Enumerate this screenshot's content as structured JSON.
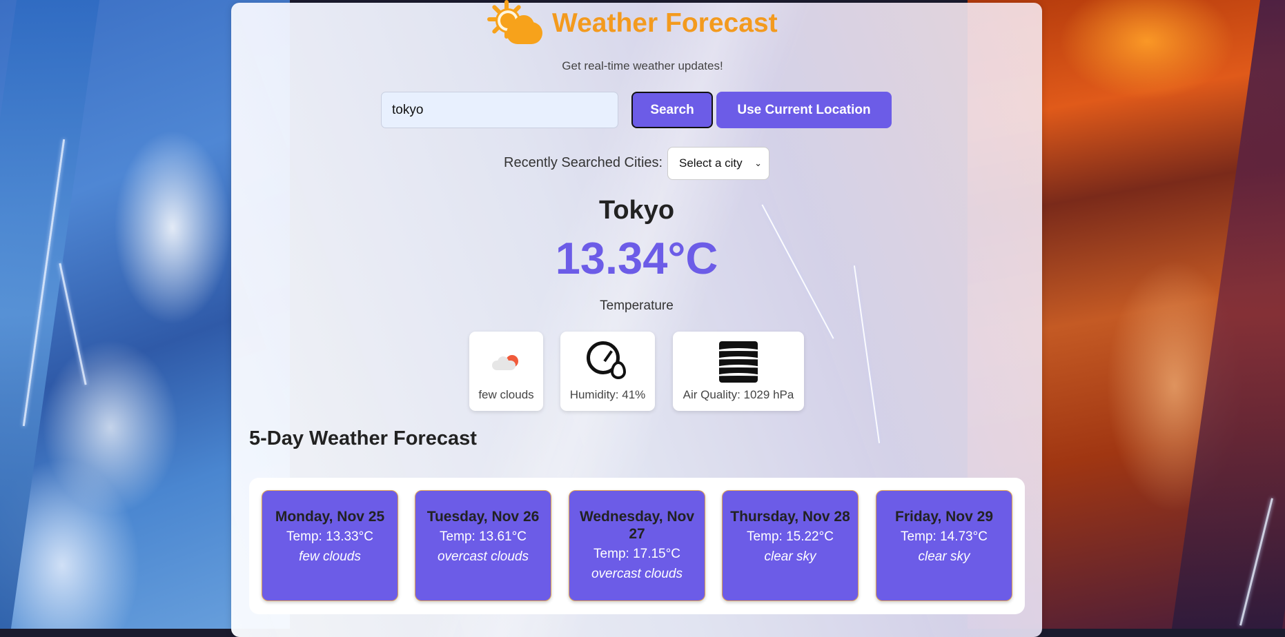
{
  "header": {
    "logo_icon": "sun-cloud-icon",
    "title": "Weather Forecast",
    "subtitle": "Get real-time weather updates!"
  },
  "search": {
    "value": "tokyo",
    "search_label": "Search",
    "location_label": "Use Current Location"
  },
  "recent": {
    "label": "Recently Searched Cities:",
    "selected": "Select a city"
  },
  "current": {
    "city": "Tokyo",
    "temperature": "13.34°C",
    "temperature_label": "Temperature",
    "condition": "few clouds",
    "condition_icon": "few-clouds-icon",
    "humidity": "Humidity: 41%",
    "humidity_icon": "humidity-gauge-icon",
    "air_quality": "Air Quality: 1029 hPa",
    "air_quality_icon": "air-quality-icon"
  },
  "forecast": {
    "title": "5-Day Weather Forecast",
    "days": [
      {
        "date": "Monday, Nov 25",
        "temp": "Temp: 13.33°C",
        "desc": "few clouds"
      },
      {
        "date": "Tuesday, Nov 26",
        "temp": "Temp: 13.61°C",
        "desc": "overcast clouds"
      },
      {
        "date": "Wednesday, Nov 27",
        "temp": "Temp: 17.15°C",
        "desc": "overcast clouds"
      },
      {
        "date": "Thursday, Nov 28",
        "temp": "Temp: 15.22°C",
        "desc": "clear sky"
      },
      {
        "date": "Friday, Nov 29",
        "temp": "Temp: 14.73°C",
        "desc": "clear sky"
      }
    ]
  },
  "colors": {
    "accent": "#6c5ce7",
    "title": "#f39a1e"
  }
}
